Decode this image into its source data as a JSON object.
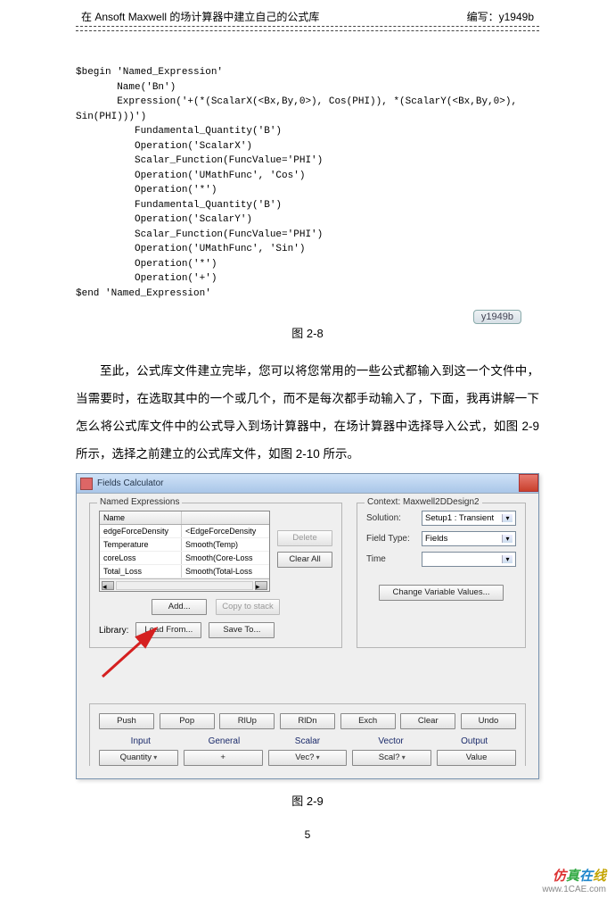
{
  "header": {
    "title": "在 Ansoft Maxwell 的场计算器中建立自己的公式库",
    "author_prefix": "编写：",
    "author": "y1949b"
  },
  "code": "$begin 'Named_Expression'\n       Name('Bn')\n       Expression('+(*(ScalarX(<Bx,By,0>), Cos(PHI)), *(ScalarY(<Bx,By,0>),\nSin(PHI)))')\n          Fundamental_Quantity('B')\n          Operation('ScalarX')\n          Scalar_Function(FuncValue='PHI')\n          Operation('UMathFunc', 'Cos')\n          Operation('*')\n          Fundamental_Quantity('B')\n          Operation('ScalarY')\n          Scalar_Function(FuncValue='PHI')\n          Operation('UMathFunc', 'Sin')\n          Operation('*')\n          Operation('+')\n$end 'Named_Expression'",
  "badge": "y1949b",
  "captions": {
    "fig28": "图 2-8",
    "fig29": "图 2-9"
  },
  "paragraph": "至此，公式库文件建立完毕，您可以将您常用的一些公式都输入到这一个文件中，当需要时，在选取其中的一个或几个，而不是每次都手动输入了，下面，我再讲解一下怎么将公式库文件中的公式导入到场计算器中，在场计算器中选择导入公式，如图 2-9 所示，选择之前建立的公式库文件，如图 2-10 所示。",
  "dialog": {
    "title": "Fields Calculator",
    "named_expr": {
      "group_label": "Named Expressions",
      "columns": [
        "Name",
        ""
      ],
      "rows": [
        {
          "name": "edgeForceDensity",
          "expr": "<EdgeForceDensity"
        },
        {
          "name": "Temperature",
          "expr": "Smooth(Temp)"
        },
        {
          "name": "coreLoss",
          "expr": "Smooth(Core-Loss"
        },
        {
          "name": "Total_Loss",
          "expr": "Smooth(Total-Loss"
        }
      ],
      "delete": "Delete",
      "clear_all": "Clear All",
      "add": "Add...",
      "copy_to_stack": "Copy to stack",
      "library_label": "Library:",
      "load_from": "Load From...",
      "save_to": "Save To..."
    },
    "context": {
      "group_label": "Context: Maxwell2DDesign2",
      "solution_label": "Solution:",
      "solution_value": "Setup1 : Transient",
      "field_type_label": "Field Type:",
      "field_type_value": "Fields",
      "time_label": "Time",
      "time_value": "",
      "change_var": "Change Variable Values..."
    },
    "calc": {
      "row1": [
        "Push",
        "Pop",
        "RlUp",
        "RlDn",
        "Exch",
        "Clear",
        "Undo"
      ],
      "headers": [
        "Input",
        "General",
        "Scalar",
        "Vector",
        "Output"
      ],
      "row2": [
        "Quantity",
        "+",
        "Vec?",
        "Scal?",
        "Value"
      ]
    }
  },
  "page_number": "5",
  "footer": {
    "brand_parts": [
      "仿",
      "真",
      "在",
      "线"
    ],
    "url": "www.1CAE.com"
  }
}
